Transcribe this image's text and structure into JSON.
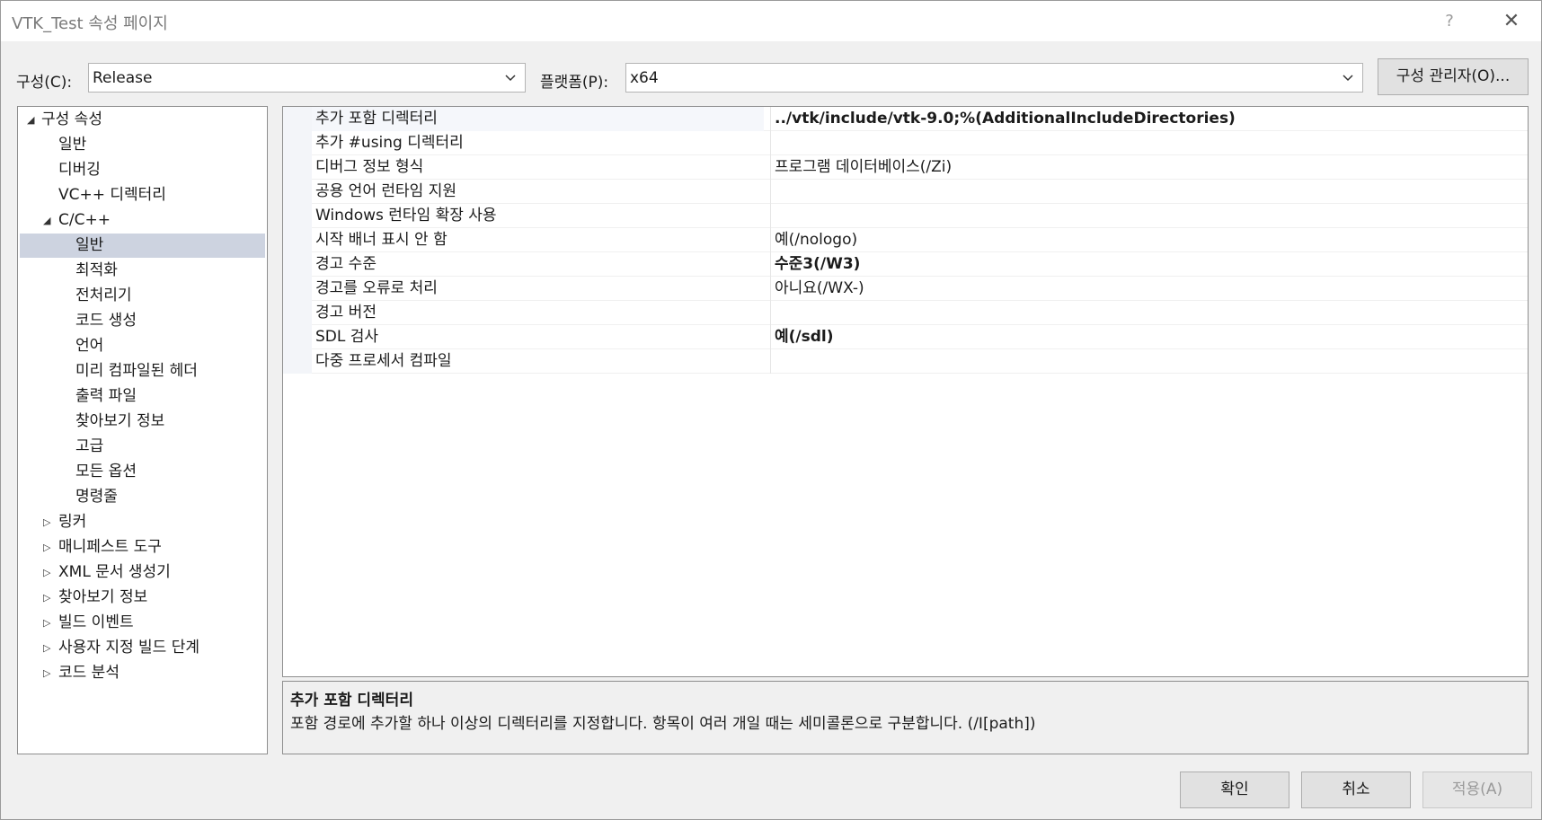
{
  "window": {
    "title": "VTK_Test 속성 페이지",
    "help": "?",
    "close": "✕"
  },
  "toolbar": {
    "config_label": "구성(C):",
    "config_value": "Release",
    "platform_label": "플랫폼(P):",
    "platform_value": "x64",
    "config_manager": "구성 관리자(O)..."
  },
  "tree": {
    "items": [
      {
        "label": "구성 속성",
        "glyph": "◢"
      },
      {
        "label": "일반"
      },
      {
        "label": "디버깅"
      },
      {
        "label": "VC++ 디렉터리"
      },
      {
        "label": "C/C++",
        "glyph": "◢"
      },
      {
        "label": "일반"
      },
      {
        "label": "최적화"
      },
      {
        "label": "전처리기"
      },
      {
        "label": "코드 생성"
      },
      {
        "label": "언어"
      },
      {
        "label": "미리 컴파일된 헤더"
      },
      {
        "label": "출력 파일"
      },
      {
        "label": "찾아보기 정보"
      },
      {
        "label": "고급"
      },
      {
        "label": "모든 옵션"
      },
      {
        "label": "명령줄"
      },
      {
        "label": "링커",
        "glyph": "▷"
      },
      {
        "label": "매니페스트 도구",
        "glyph": "▷"
      },
      {
        "label": "XML 문서 생성기",
        "glyph": "▷"
      },
      {
        "label": "찾아보기 정보",
        "glyph": "▷"
      },
      {
        "label": "빌드 이벤트",
        "glyph": "▷"
      },
      {
        "label": "사용자 지정 빌드 단계",
        "glyph": "▷"
      },
      {
        "label": "코드 분석",
        "glyph": "▷"
      }
    ]
  },
  "properties": {
    "rows": [
      {
        "name": "추가 포함 디렉터리",
        "value": "../vtk/include/vtk-9.0;%(AdditionalIncludeDirectories)"
      },
      {
        "name": "추가 #using 디렉터리",
        "value": ""
      },
      {
        "name": "디버그 정보 형식",
        "value": "프로그램 데이터베이스(/Zi)"
      },
      {
        "name": "공용 언어 런타임 지원",
        "value": ""
      },
      {
        "name": "Windows 런타임 확장 사용",
        "value": ""
      },
      {
        "name": "시작 배너 표시 안 함",
        "value": "예(/nologo)"
      },
      {
        "name": "경고 수준",
        "value": "수준3(/W3)"
      },
      {
        "name": "경고를 오류로 처리",
        "value": "아니요(/WX-)"
      },
      {
        "name": "경고 버전",
        "value": ""
      },
      {
        "name": "SDL 검사",
        "value": "예(/sdl)"
      },
      {
        "name": "다중 프로세서 컴파일",
        "value": ""
      }
    ]
  },
  "description": {
    "title": "추가 포함 디렉터리",
    "body": "포함 경로에 추가할 하나 이상의 디렉터리를 지정합니다. 항목이 여러 개일 때는 세미콜론으로 구분합니다.      (/I[path])"
  },
  "buttons": {
    "ok": "확인",
    "cancel": "취소",
    "apply": "적용(A)"
  }
}
